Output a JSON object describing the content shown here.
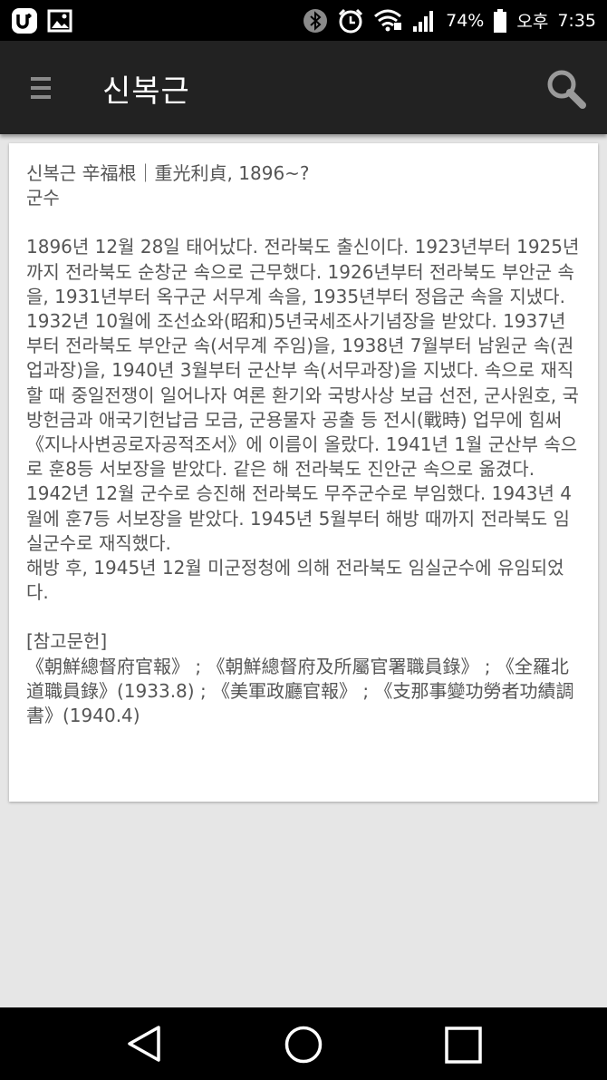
{
  "status_bar": {
    "battery_percent": "74%",
    "ampm": "오후",
    "time": "7:35",
    "icons": [
      "uplus-icon",
      "image-notification-icon",
      "bluetooth-icon",
      "alarm-icon",
      "wifi-icon",
      "signal-icon",
      "battery-icon"
    ]
  },
  "app_bar": {
    "title": "신복근",
    "menu_icon": "hamburger-menu-icon",
    "search_icon": "search-icon"
  },
  "article": {
    "heading": "신복근 辛福根｜重光利貞, 1896~?",
    "occupation": "군수",
    "body": [
      "1896년 12월 28일 태어났다. 전라북도 출신이다. 1923년부터 1925년까지 전라북도 순창군 속으로 근무했다. 1926년부터 전라북도 부안군 속을, 1931년부터 옥구군 서무계 속을, 1935년부터 정읍군 속을 지냈다. 1932년 10월에 조선쇼와(昭和)5년국세조사기념장을 받았다. 1937년부터 전라북도 부안군 속(서무계 주임)을, 1938년 7월부터 남원군 속(권업과장)을, 1940년 3월부터 군산부 속(서무과장)을 지냈다. 속으로 재직할 때 중일전쟁이 일어나자 여론 환기와 국방사상 보급 선전, 군사원호, 국방헌금과 애국기헌납금 모금, 군용물자 공출 등 전시(戰時) 업무에 힘써 《지나사변공로자공적조서》에 이름이 올랐다. 1941년 1월 군산부 속으로 훈8등 서보장을 받았다. 같은 해 전라북도 진안군 속으로 옮겼다.",
      "1942년 12월 군수로 승진해 전라북도 무주군수로 부임했다. 1943년 4월에 훈7등 서보장을 받았다. 1945년 5월부터 해방 때까지 전라북도 임실군수로 재직했다.",
      "해방 후, 1945년 12월 미군정청에 의해 전라북도 임실군수에 유임되었다."
    ],
    "references_heading": "[참고문헌]",
    "references": "《朝鮮總督府官報》 ; 《朝鮮總督府及所屬官署職員錄》 ; 《全羅北道職員錄》(1933.8) ; 《美軍政廳官報》 ; 《支那事變功勞者功績調書》(1940.4)"
  },
  "navigation_bar": {
    "buttons": [
      "back-icon",
      "home-icon",
      "recents-icon"
    ]
  },
  "colors": {
    "status_bar_bg": "#000000",
    "app_bar_bg": "#222222",
    "page_bg": "#e6e6e6",
    "card_bg": "#ffffff",
    "text": "#555555",
    "icon_grey": "#8a8a8a"
  }
}
